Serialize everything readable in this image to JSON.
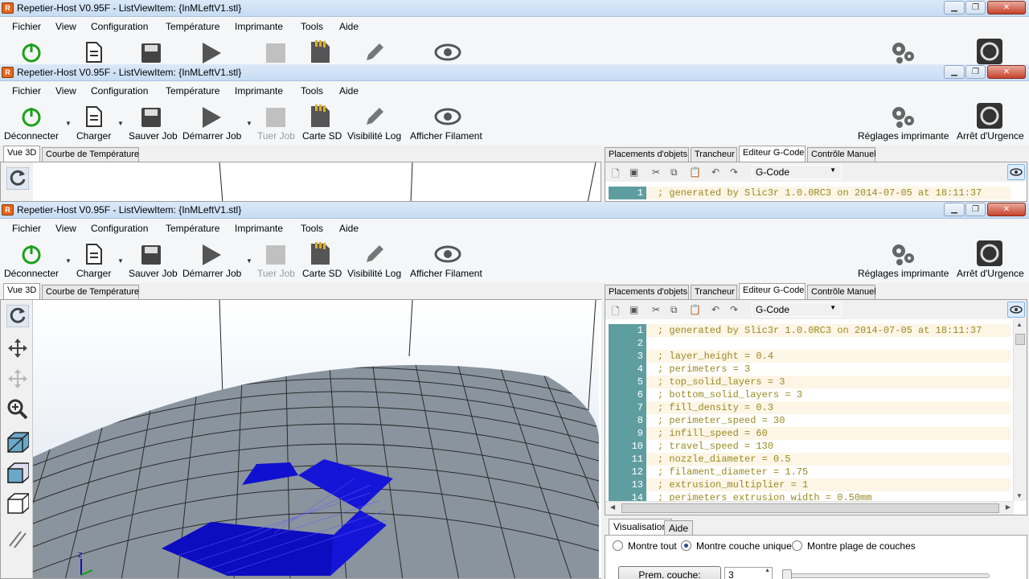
{
  "window": {
    "title": "Repetier-Host V0.95F - ListViewItem: {InMLeftV1.stl}",
    "app_icon": "R",
    "controls": {
      "minimize": "▁",
      "maximize": "❐",
      "close": "✕"
    }
  },
  "menu": [
    "Fichier",
    "View",
    "Configuration",
    "Température",
    "Imprimante",
    "Tools",
    "Aide"
  ],
  "toolbar": {
    "disconnect": "Déconnecter",
    "load": "Charger",
    "save_job": "Sauver Job",
    "start_job": "Démarrer Job",
    "kill_job": "Tuer Job",
    "sd_card": "Carte SD",
    "log_visibility": "Visibilité Log",
    "show_filament": "Afficher Filament",
    "printer_settings": "Réglages imprimante",
    "emergency_stop": "Arrêt d'Urgence"
  },
  "left_tabs": {
    "view3d": "Vue 3D",
    "temp_curve": "Courbe de Température"
  },
  "right_tabs": {
    "placements": "Placements d'objets",
    "slicer": "Trancheur",
    "gcode_editor": "Editeur G-Code",
    "manual_control": "Contrôle Manuel"
  },
  "gcode": {
    "selector": "G-Code",
    "lines": [
      {
        "n": "1",
        "text": "; generated by Slic3r 1.0.0RC3 on 2014-07-05 at 18:11:37"
      },
      {
        "n": "2",
        "text": ""
      },
      {
        "n": "3",
        "text": "; layer_height = 0.4"
      },
      {
        "n": "4",
        "text": "; perimeters = 3"
      },
      {
        "n": "5",
        "text": "; top_solid_layers = 3"
      },
      {
        "n": "6",
        "text": "; bottom_solid_layers = 3"
      },
      {
        "n": "7",
        "text": "; fill_density = 0.3"
      },
      {
        "n": "8",
        "text": "; perimeter_speed = 30"
      },
      {
        "n": "9",
        "text": "; infill_speed = 60"
      },
      {
        "n": "10",
        "text": "; travel_speed = 130"
      },
      {
        "n": "11",
        "text": "; nozzle_diameter = 0.5"
      },
      {
        "n": "12",
        "text": "; filament_diameter = 1.75"
      },
      {
        "n": "13",
        "text": "; extrusion_multiplier = 1"
      },
      {
        "n": "14",
        "text": "; perimeters extrusion width = 0.50mm"
      }
    ]
  },
  "view_tabs": {
    "visualisation": "Visualisation",
    "aide": "Aide"
  },
  "visualisation": {
    "show_all": "Montre tout",
    "single_layer": "Montre couche unique",
    "layer_range": "Montre plage de couches",
    "first_layer_button": "Prem. couche:",
    "first_layer_value": "3"
  },
  "colors": {
    "accent_teal": "#5f9ea0",
    "gcode_text": "#9a8a20",
    "model_blue": "#1010d0",
    "bed_grey": "#8a949e"
  }
}
